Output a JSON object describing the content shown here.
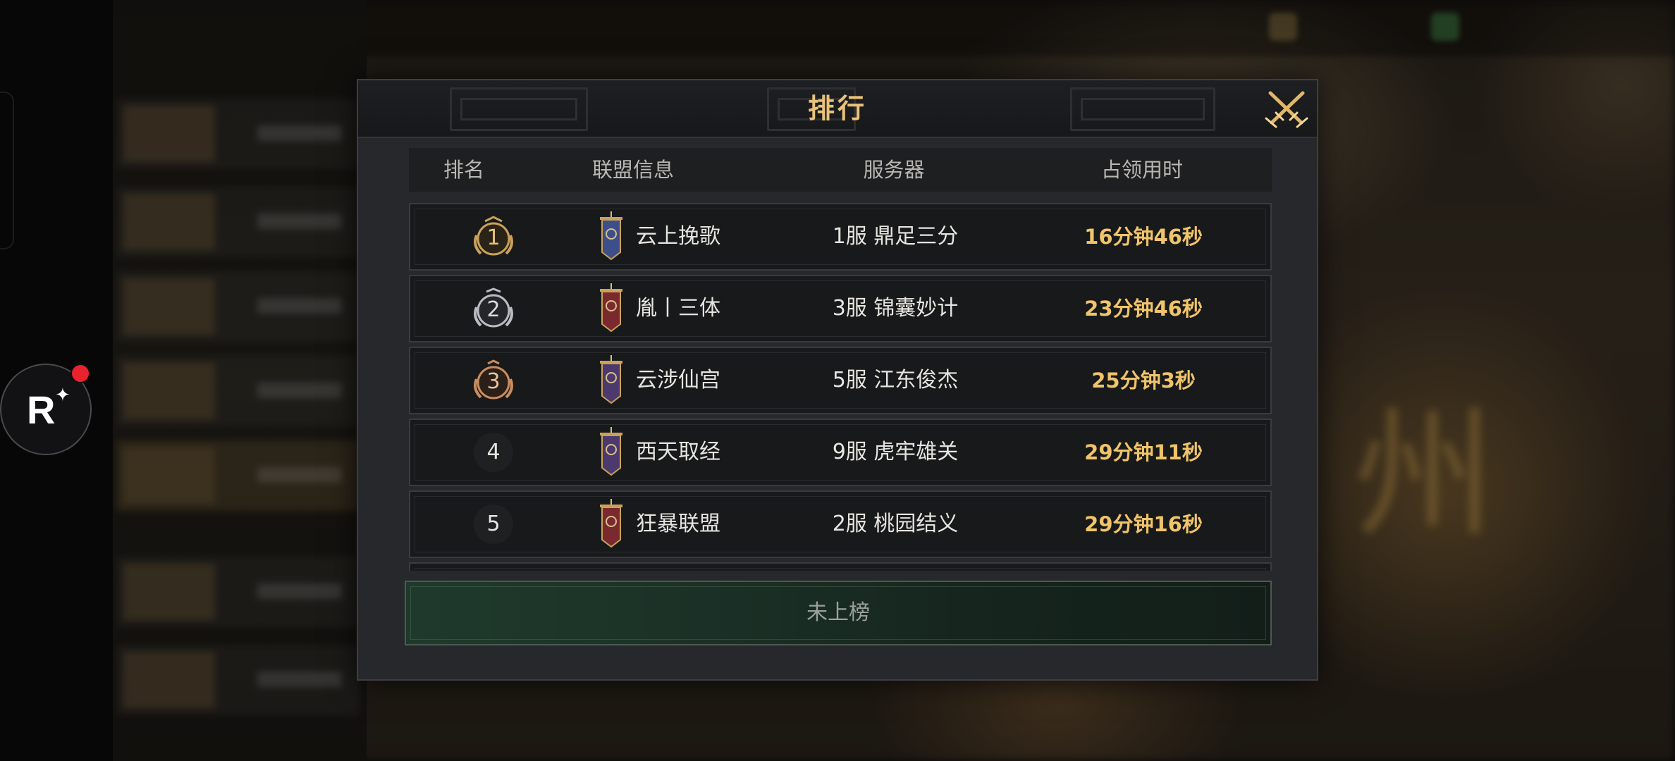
{
  "dialog": {
    "title": "排行",
    "columns": [
      "排名",
      "联盟信息",
      "服务器",
      "占领用时"
    ],
    "rows": [
      {
        "rank": "1",
        "alliance": "云上挽歌",
        "server": "1服  鼎足三分",
        "time": "16分钟46秒",
        "badge": "gold",
        "banner": "blue"
      },
      {
        "rank": "2",
        "alliance": "胤丨三体",
        "server": "3服  锦囊妙计",
        "time": "23分钟46秒",
        "badge": "silver",
        "banner": "red"
      },
      {
        "rank": "3",
        "alliance": "云涉仙宫",
        "server": "5服  江东俊杰",
        "time": "25分钟3秒",
        "badge": "bronze",
        "banner": "purple"
      },
      {
        "rank": "4",
        "alliance": "西天取经",
        "server": "9服  虎牢雄关",
        "time": "29分钟11秒",
        "badge": "none",
        "banner": "purple"
      },
      {
        "rank": "5",
        "alliance": "狂暴联盟",
        "server": "2服  桃园结义",
        "time": "29分钟16秒",
        "badge": "none",
        "banner": "red"
      }
    ],
    "footer_label": "未上榜"
  },
  "floating_button": {
    "label": "R"
  },
  "colors": {
    "title_gold": "#e9c27a",
    "time_gold": "#f0c46a",
    "rank_gold": "#c9a25a",
    "rank_silver": "#b8bcc2",
    "rank_bronze": "#c98d5e",
    "banner_blue": "#3d4f8a",
    "banner_red": "#7a2a2f",
    "banner_purple": "#4c3a6e"
  },
  "icons": {
    "close": "crossed-swords-icon",
    "banner": "banner-icon",
    "rank_badge": "laurel-badge-icon"
  }
}
